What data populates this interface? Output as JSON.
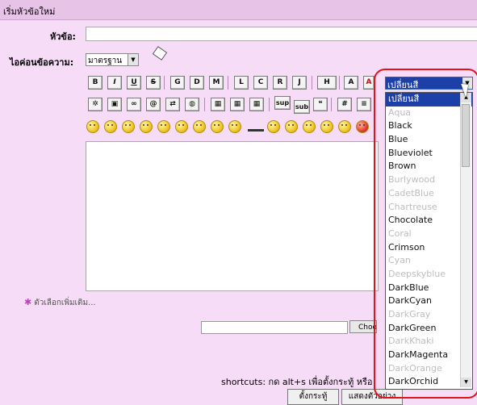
{
  "header": {
    "title": "เริ่มหัวข้อใหม่"
  },
  "form": {
    "subject_label": "หัวข้อ:",
    "subject_value": "",
    "icon_label": "ไอค่อนข้อความ:",
    "icon_value": "มาตรฐาน",
    "message_value": ""
  },
  "toolbar": {
    "row1": [
      "B",
      "I",
      "U",
      "S",
      "G",
      "D",
      "M",
      "L",
      "C",
      "R",
      "J",
      "H",
      "A",
      "A"
    ],
    "row2": [
      "flash",
      "img",
      "url",
      "email",
      "ftp",
      "table",
      "tr",
      "td",
      "sup",
      "sub",
      "quote",
      "#",
      "php"
    ]
  },
  "color_dropdown": {
    "selected": "เปลี่ยนสี",
    "options": [
      {
        "label": "เปลี่ยนสี",
        "style": "sel"
      },
      {
        "label": "Aqua",
        "style": "dim"
      },
      {
        "label": "Black",
        "style": "dark"
      },
      {
        "label": "Blue",
        "style": "dark"
      },
      {
        "label": "Blueviolet",
        "style": "dark"
      },
      {
        "label": "Brown",
        "style": "dark"
      },
      {
        "label": "Burlywood",
        "style": "dim"
      },
      {
        "label": "CadetBlue",
        "style": "dim"
      },
      {
        "label": "Chartreuse",
        "style": "dim"
      },
      {
        "label": "Chocolate",
        "style": "dark"
      },
      {
        "label": "Coral",
        "style": "dim"
      },
      {
        "label": "Crimson",
        "style": "dark"
      },
      {
        "label": "Cyan",
        "style": "dim"
      },
      {
        "label": "Deepskyblue",
        "style": "dim"
      },
      {
        "label": "DarkBlue",
        "style": "dark"
      },
      {
        "label": "DarkCyan",
        "style": "dark"
      },
      {
        "label": "DarkGray",
        "style": "dim"
      },
      {
        "label": "DarkGreen",
        "style": "dark"
      },
      {
        "label": "DarkKhaki",
        "style": "dim"
      },
      {
        "label": "DarkMagenta",
        "style": "dark"
      },
      {
        "label": "DarkOrange",
        "style": "dim"
      },
      {
        "label": "DarkOrchid",
        "style": "dark"
      }
    ]
  },
  "more_options": "ตัวเลือกเพิ่มเติม...",
  "attachment": {
    "choose_label": "Choose"
  },
  "shortcuts": "shortcuts: กด alt+s เพื่อตั้งกระทู้ หรือ",
  "buttons": {
    "submit": "ตั้งกระทู้",
    "preview": "แสดงตัวอย่าง"
  },
  "colors": {
    "background": "#f6dcf6",
    "highlight": "#e0121c",
    "selected": "#1d3fa8"
  }
}
